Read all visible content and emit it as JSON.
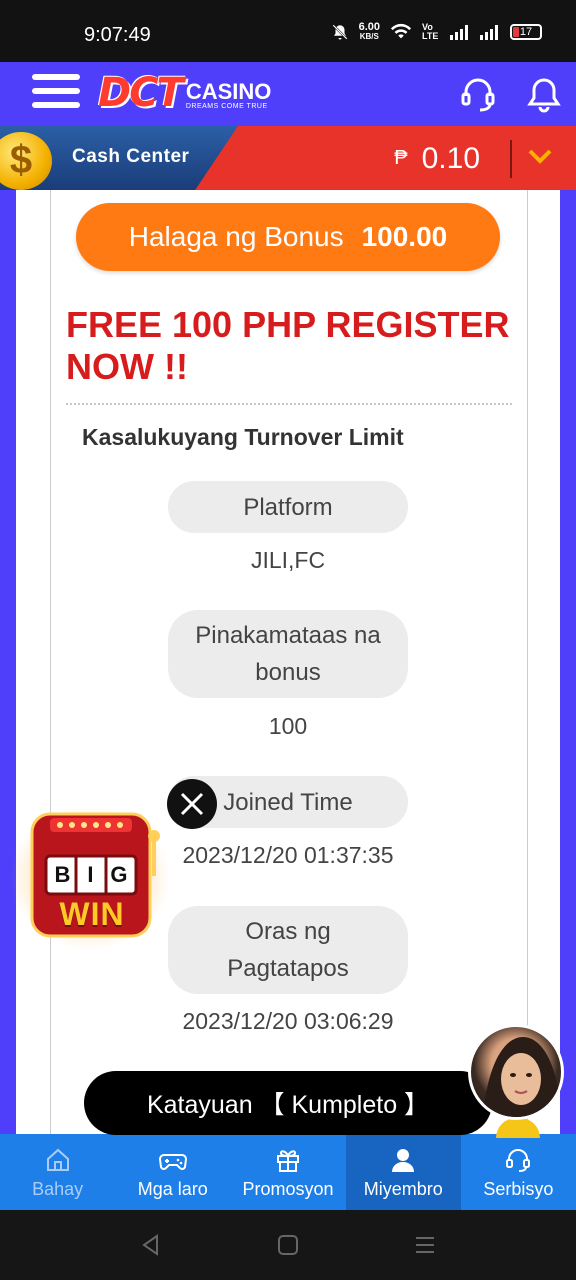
{
  "status_bar": {
    "time": "9:07:49",
    "net_speed_value": "6.00",
    "net_speed_unit": "KB/S",
    "volte": "Vo LTE",
    "battery": "17"
  },
  "header": {
    "logo_mark": "DCT",
    "logo_name": "CASINO",
    "logo_tagline": "DREAMS COME TRUE"
  },
  "cash_center": {
    "label": "Cash Center",
    "currency_symbol": "₱",
    "balance": "0.10"
  },
  "bonus": {
    "label": "Halaga ng Bonus",
    "amount": "100.00"
  },
  "promo_title": "FREE 100 PHP REGISTER NOW !!",
  "turnover": {
    "heading": "Kasalukuyang Turnover Limit",
    "fields": [
      {
        "label": "Platform",
        "value": "JILI,FC"
      },
      {
        "label": "Pinakamataas na bonus",
        "value": "100"
      },
      {
        "label": "Joined Time",
        "value": "2023/12/20 01:37:35"
      },
      {
        "label": "Oras ng Pagtatapos",
        "value": "2023/12/20 03:06:29"
      }
    ]
  },
  "status": "Katayuan 【 Kumpleto 】",
  "floating": {
    "bigwin_line1": "BIG",
    "bigwin_line2": "WIN"
  },
  "bottom_nav": [
    {
      "label": "Bahay",
      "icon": "home-icon"
    },
    {
      "label": "Mga laro",
      "icon": "gamepad-icon"
    },
    {
      "label": "Promosyon",
      "icon": "gift-icon"
    },
    {
      "label": "Miyembro",
      "icon": "user-icon"
    },
    {
      "label": "Serbisyo",
      "icon": "headset-icon"
    }
  ],
  "colors": {
    "header": "#4f3ffb",
    "cash_red": "#e8332b",
    "bonus_orange": "#ff7a12",
    "promo_red": "#d61c1c",
    "nav_blue": "#1e7fe8"
  }
}
